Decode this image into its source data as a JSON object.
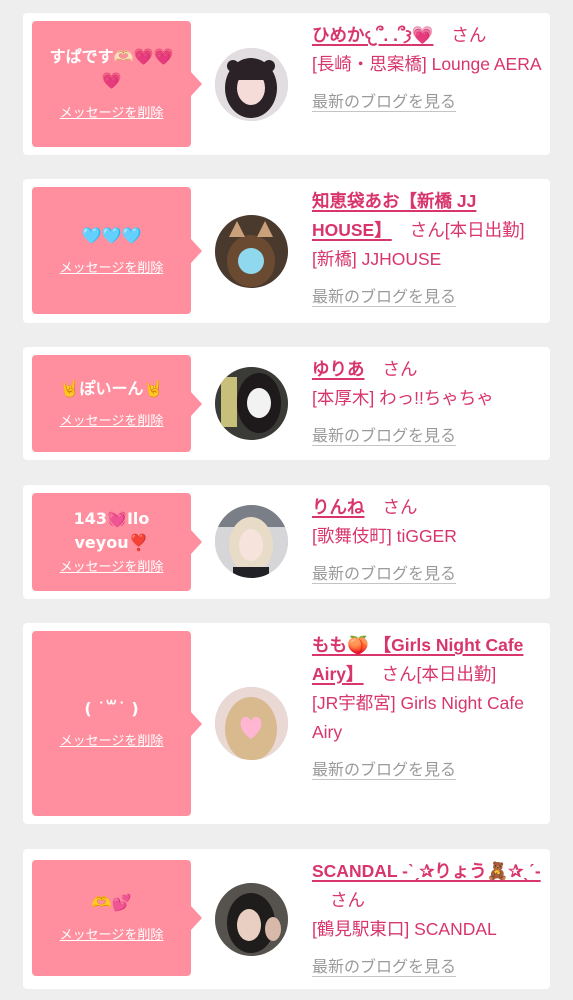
{
  "delete_label": "メッセージを削除",
  "san_label": "さん",
  "blog_label": "最新のブログを見る",
  "colors": {
    "bubble": "#ff8f9f",
    "accent": "#d8356c",
    "muted": "#9a9a9a",
    "background": "#eeeeee"
  },
  "items": [
    {
      "message": "すぱです🫶🏻💗💗💗",
      "name": "ひめか𐔌՞. .՞𐦯💗",
      "status": "",
      "shop": "[長崎・思案橋] Lounge AERA",
      "avatar_icon": "girl-avatar-icon"
    },
    {
      "message": "🩵🩵🩵",
      "name": "知恵袋あお【新橋 JJ HOUSE】",
      "status": "[本日出勤]",
      "shop": "[新橋] JJHOUSE",
      "avatar_icon": "girl-avatar-icon"
    },
    {
      "message": "🤘ぽいーん🤘",
      "name": "ゆりあ",
      "status": "",
      "shop": "[本厚木] わっ!!ちゃちゃ",
      "avatar_icon": "girl-avatar-icon"
    },
    {
      "message": "143💓Iloveyou❣️",
      "name": "りんね",
      "status": "",
      "shop": "[歌舞伎町] tiGGER",
      "avatar_icon": "girl-avatar-icon"
    },
    {
      "message": "( ˙꒳˙ )",
      "name": "もも🍑 【Girls Night Cafe Airy】",
      "status": "[本日出勤]",
      "shop": "[JR宇都宮] Girls Night Cafe Airy",
      "avatar_icon": "girl-avatar-icon"
    },
    {
      "message": "🫶💕",
      "name": "SCANDAL -ˋˏ✰りょう🧸✰ˎˊ-",
      "status": "",
      "shop": "[鶴見駅東口] SCANDAL",
      "avatar_icon": "girl-avatar-icon"
    }
  ]
}
